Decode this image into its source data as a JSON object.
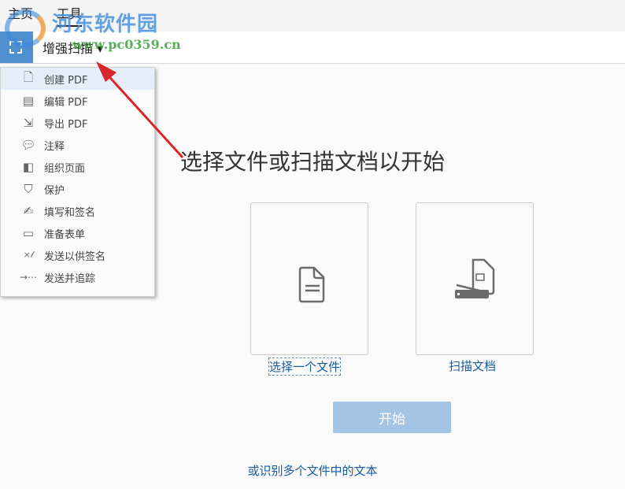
{
  "tabs": {
    "home": "主页",
    "tools": "工具"
  },
  "toolbar": {
    "tool_name": "增强扫描 ▾"
  },
  "watermark": {
    "name": "河东软件园",
    "url": "www.pc0359.cn"
  },
  "menu": [
    {
      "label": "创建 PDF",
      "icon": "create-pdf-icon"
    },
    {
      "label": "编辑 PDF",
      "icon": "edit-pdf-icon"
    },
    {
      "label": "导出 PDF",
      "icon": "export-pdf-icon"
    },
    {
      "label": "注释",
      "icon": "comment-icon"
    },
    {
      "label": "组织页面",
      "icon": "organize-pages-icon"
    },
    {
      "label": "保护",
      "icon": "shield-icon"
    },
    {
      "label": "填写和签名",
      "icon": "fill-sign-icon"
    },
    {
      "label": "准备表单",
      "icon": "form-icon"
    },
    {
      "label": "发送以供签名",
      "icon": "send-sign-icon"
    },
    {
      "label": "发送并追踪",
      "icon": "send-track-icon"
    }
  ],
  "main": {
    "heading": "选择文件或扫描文档以开始",
    "select_file": "选择一个文件",
    "scan_doc": "扫描文档",
    "start": "开始",
    "ocr_link": "或识别多个文件中的文本"
  }
}
